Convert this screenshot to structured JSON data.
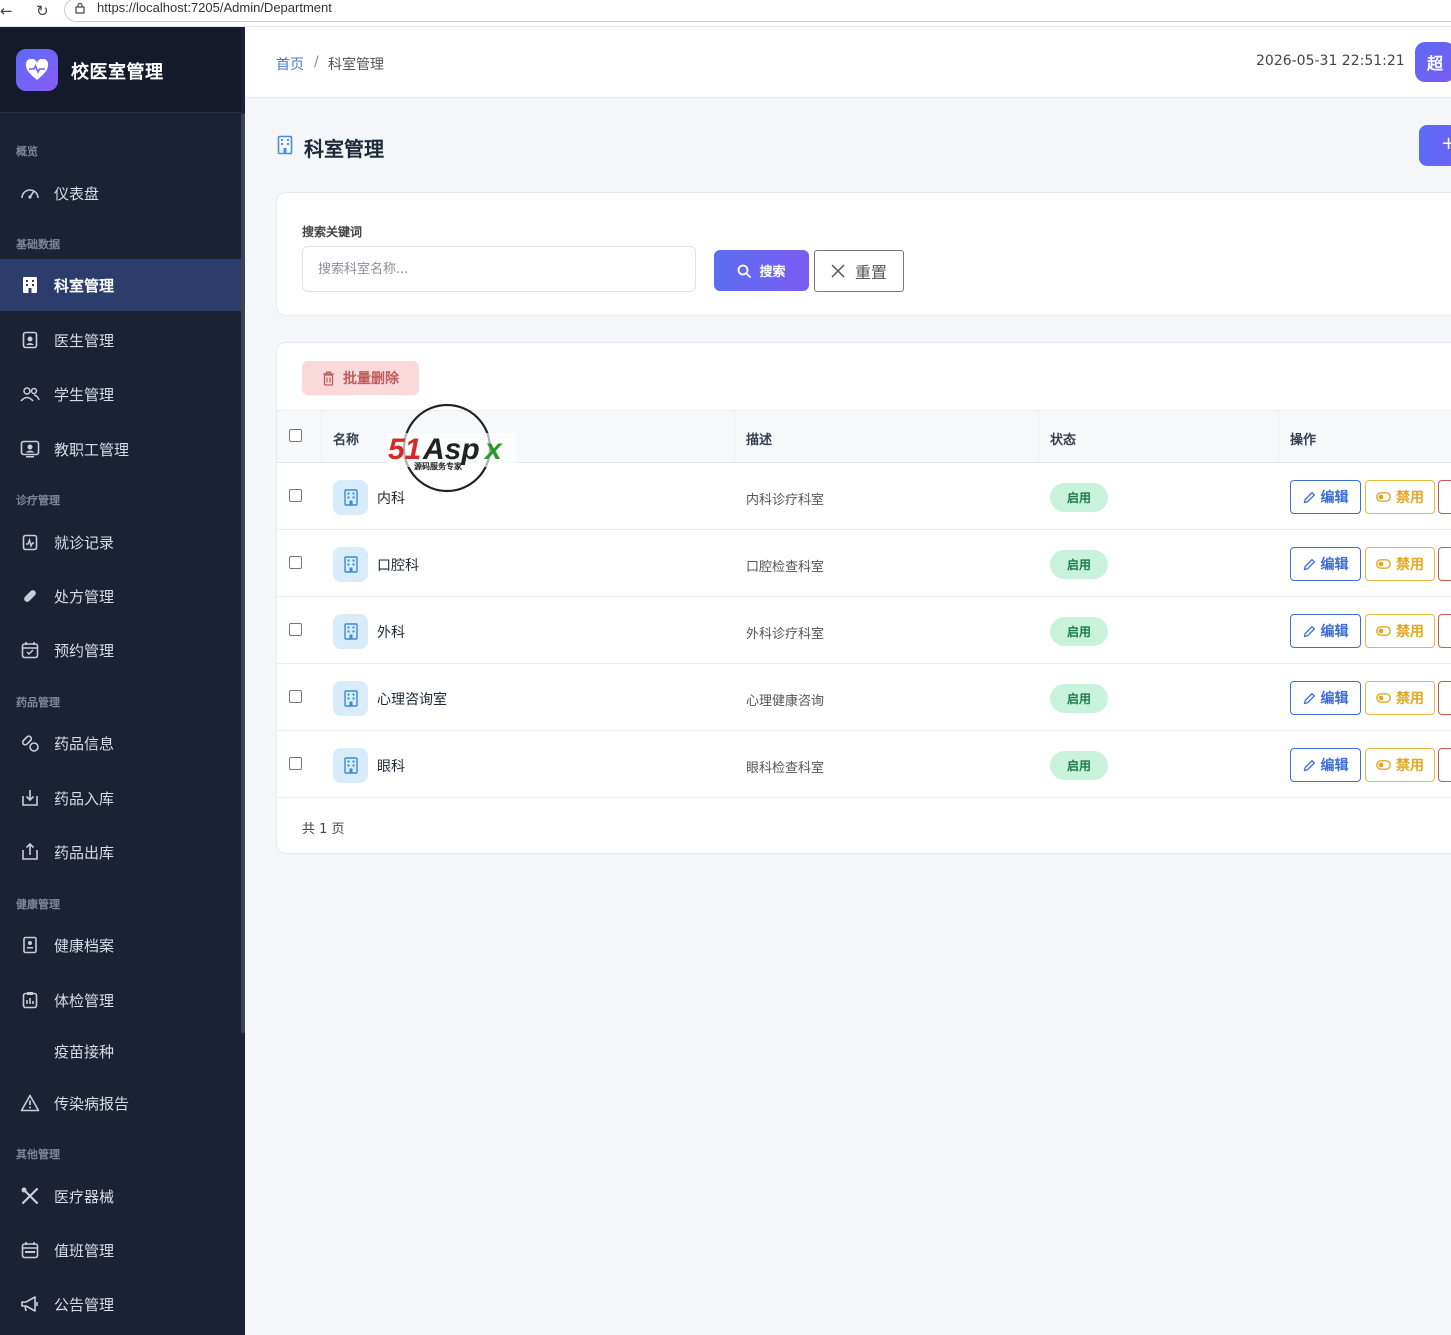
{
  "browser": {
    "url": "https://localhost:7205/Admin/Department"
  },
  "brand": {
    "title": "校医室管理"
  },
  "sidebar": {
    "groups": [
      "概览",
      "基础数据",
      "诊疗管理",
      "药品管理",
      "健康管理",
      "其他管理"
    ],
    "items": [
      {
        "label": "仪表盘",
        "icon": "gauge-icon"
      },
      {
        "label": "科室管理",
        "icon": "building-icon"
      },
      {
        "label": "医生管理",
        "icon": "id-badge-icon"
      },
      {
        "label": "学生管理",
        "icon": "users-icon"
      },
      {
        "label": "教职工管理",
        "icon": "person-card-icon"
      },
      {
        "label": "就诊记录",
        "icon": "clipboard-pulse-icon"
      },
      {
        "label": "处方管理",
        "icon": "pill-icon"
      },
      {
        "label": "预约管理",
        "icon": "calendar-check-icon"
      },
      {
        "label": "药品信息",
        "icon": "capsules-icon"
      },
      {
        "label": "药品入库",
        "icon": "box-in-icon"
      },
      {
        "label": "药品出库",
        "icon": "box-out-icon"
      },
      {
        "label": "健康档案",
        "icon": "file-medical-icon"
      },
      {
        "label": "体检管理",
        "icon": "clipboard-list-icon"
      },
      {
        "label": "疫苗接种",
        "icon": "syringe-icon"
      },
      {
        "label": "传染病报告",
        "icon": "warning-icon"
      },
      {
        "label": "医疗器械",
        "icon": "tools-icon"
      },
      {
        "label": "值班管理",
        "icon": "calendar-week-icon"
      },
      {
        "label": "公告管理",
        "icon": "megaphone-icon"
      }
    ],
    "active": "科室管理"
  },
  "header": {
    "breadcrumb_home": "首页",
    "breadcrumb_sep": "/",
    "breadcrumb_current": "科室管理",
    "datetime": "2026-05-31 22:51:21",
    "avatar_text": "超"
  },
  "page": {
    "title": "科室管理",
    "add_label": "+"
  },
  "search": {
    "label": "搜索关键词",
    "placeholder": "搜索科室名称...",
    "value": "",
    "search_label": "搜索",
    "reset_label": "重置"
  },
  "table": {
    "batch_delete_label": "批量删除",
    "columns": [
      "名称",
      "描述",
      "状态",
      "操作"
    ],
    "rows": [
      {
        "name": "内科",
        "desc": "内科诊疗科室",
        "status": "启用",
        "edit": "编辑",
        "disable": "禁用"
      },
      {
        "name": "口腔科",
        "desc": "口腔检查科室",
        "status": "启用",
        "edit": "编辑",
        "disable": "禁用"
      },
      {
        "name": "外科",
        "desc": "外科诊疗科室",
        "status": "启用",
        "edit": "编辑",
        "disable": "禁用"
      },
      {
        "name": "心理咨询室",
        "desc": "心理健康咨询",
        "status": "启用",
        "edit": "编辑",
        "disable": "禁用"
      },
      {
        "name": "眼科",
        "desc": "眼科检查科室",
        "status": "启用",
        "edit": "编辑",
        "disable": "禁用"
      }
    ],
    "pager_text": "共 1 页"
  },
  "watermark": {
    "text": "51Aspx",
    "subtitle": "源码服务专家"
  },
  "colors": {
    "sidebar_bg": "#1b2234",
    "accent": "#5b6cf5",
    "active_item": "#2c3d6b",
    "status_green": "#c9f2dc"
  }
}
